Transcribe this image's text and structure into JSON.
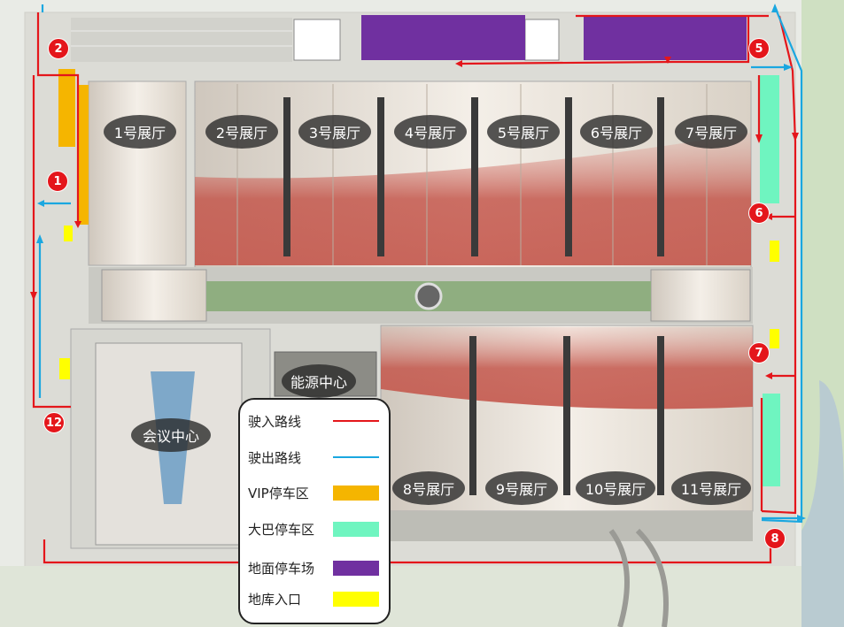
{
  "halls": {
    "h1": "1号展厅",
    "h2": "2号展厅",
    "h3": "3号展厅",
    "h4": "4号展厅",
    "h5": "5号展厅",
    "h6": "6号展厅",
    "h7": "7号展厅",
    "h8": "8号展厅",
    "h9": "9号展厅",
    "h10": "10号展厅",
    "h11": "11号展厅"
  },
  "buildings": {
    "conference": "会议中心",
    "energy": "能源中心"
  },
  "gates": {
    "g1": "1",
    "g2": "2",
    "g5": "5",
    "g6": "6",
    "g7": "7",
    "g8": "8",
    "g12": "12"
  },
  "legend": {
    "entry_route": "驶入路线",
    "exit_route": "驶出路线",
    "vip_parking": "VIP停车区",
    "bus_parking": "大巴停车区",
    "ground_parking": "地面停车场",
    "underground_entrance": "地库入口"
  },
  "colors": {
    "entry": "#e4161b",
    "exit": "#1aa7e0",
    "vip": "#f5b500",
    "bus": "#6ff5c0",
    "ground": "#7030a0",
    "underground": "#ffff00"
  }
}
